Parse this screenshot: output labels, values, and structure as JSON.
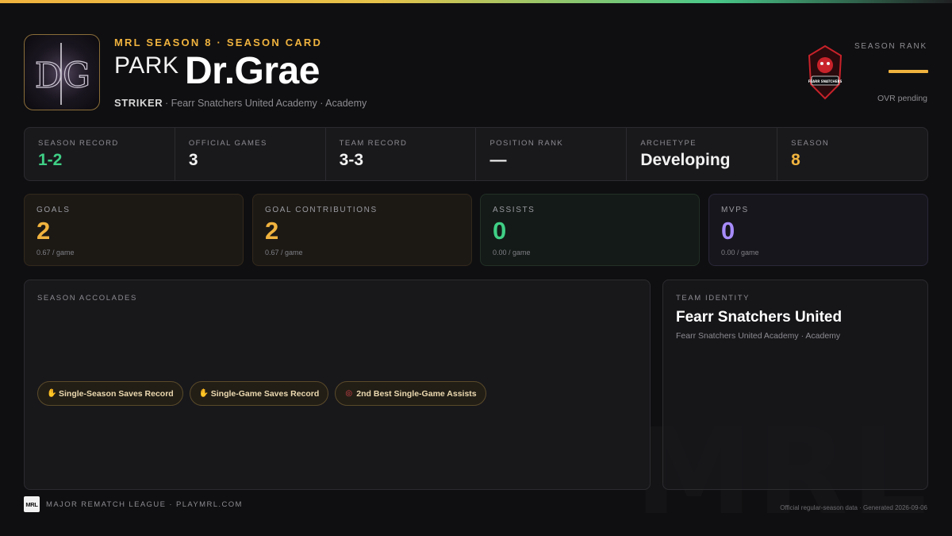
{
  "header": {
    "kicker": "MRL SEASON 8 · SEASON CARD",
    "first_name": "PARK",
    "last_name": "Dr.Grae",
    "position": "STRIKER",
    "team_line": "· Fearr Snatchers United Academy · Academy",
    "logo_letters": "DG",
    "team_logo_text": "FEARR SNATCHERS",
    "season_rank_label": "SEASON RANK",
    "ovr_status": "OVR pending"
  },
  "stats": [
    {
      "label": "SEASON RECORD",
      "value": "1-2"
    },
    {
      "label": "OFFICIAL GAMES",
      "value": "3"
    },
    {
      "label": "TEAM RECORD",
      "value": "3-3"
    },
    {
      "label": "POSITION RANK",
      "value": "—"
    },
    {
      "label": "ARCHETYPE",
      "value": "Developing"
    },
    {
      "label": "SEASON",
      "value": "8"
    }
  ],
  "cards": [
    {
      "label": "GOALS",
      "value": "2",
      "sub": "0.67 / game"
    },
    {
      "label": "GOAL CONTRIBUTIONS",
      "value": "2",
      "sub": "0.67 / game"
    },
    {
      "label": "ASSISTS",
      "value": "0",
      "sub": "0.00 / game"
    },
    {
      "label": "MVPS",
      "value": "0",
      "sub": "0.00 / game"
    }
  ],
  "accolades": {
    "label": "SEASON ACCOLADES",
    "items": [
      {
        "icon": "gloves-icon",
        "text": "Single-Season Saves Record"
      },
      {
        "icon": "gloves-icon",
        "text": "Single-Game Saves Record"
      },
      {
        "icon": "target-icon",
        "text": "2nd Best Single-Game Assists"
      }
    ]
  },
  "team_identity": {
    "label": "TEAM IDENTITY",
    "name": "Fearr Snatchers United",
    "sub": "Fearr Snatchers United Academy · Academy"
  },
  "footer": {
    "badge": "MRL",
    "brand": "MAJOR REMATCH LEAGUE · PLAYMRL.COM",
    "note": "Official regular-season data · Generated 2026-09-06",
    "watermark": "MRL"
  },
  "colors": {
    "accent_gold": "#f0b33e",
    "accent_green": "#3fcf85",
    "accent_purple": "#a78bfa",
    "background": "#0f0f11"
  }
}
